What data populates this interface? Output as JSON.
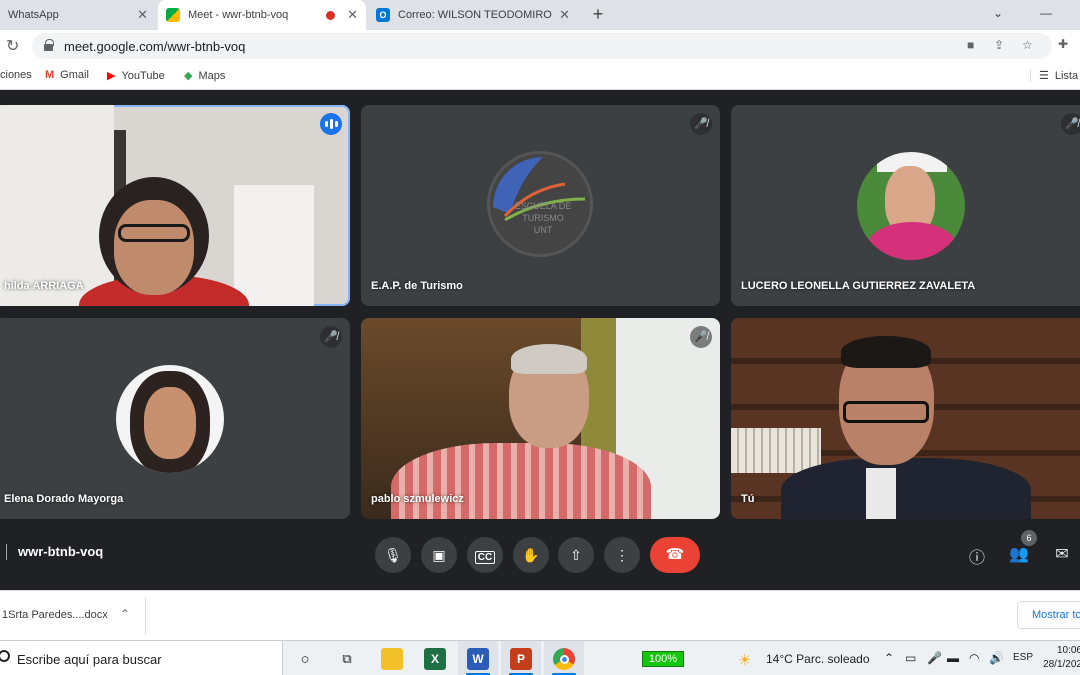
{
  "browser": {
    "tabs": [
      {
        "title": "WhatsApp",
        "active": false
      },
      {
        "title": "Meet - wwr-btnb-voq",
        "active": true
      },
      {
        "title": "Correo: WILSON TEODOMIRO SA",
        "active": false
      }
    ],
    "url": "meet.google.com/wwr-btnb-voq",
    "bookmarks": [
      {
        "label": "ciones",
        "icon": "apps-icon"
      },
      {
        "label": "Gmail",
        "icon": "gmail-icon",
        "color": "#ea4335"
      },
      {
        "label": "YouTube",
        "icon": "youtube-icon",
        "color": "#ff0000"
      },
      {
        "label": "Maps",
        "icon": "maps-icon",
        "color": "#34a853"
      }
    ],
    "reading_list": "Lista"
  },
  "meet": {
    "meeting_code": "wwr-btnb-voq",
    "participant_count": "6",
    "participants": [
      {
        "name": "hilda ARRIAGA",
        "speaking": true,
        "muted": false,
        "video": true
      },
      {
        "name": "E.A.P. de Turismo",
        "speaking": false,
        "muted": true,
        "video": false
      },
      {
        "name": "LUCERO LEONELLA GUTIERREZ ZAVALETA",
        "speaking": false,
        "muted": true,
        "video": false
      },
      {
        "name": "Elena Dorado Mayorga",
        "speaking": false,
        "muted": true,
        "video": false
      },
      {
        "name": "pablo szmulewicz",
        "speaking": false,
        "muted": true,
        "video": true
      },
      {
        "name": "Tú",
        "speaking": false,
        "muted": false,
        "video": true
      }
    ],
    "logo_text": {
      "line1": "ESCUELA DE",
      "line2": "TURISMO",
      "line3": "UNT"
    },
    "controls": [
      "mic-icon",
      "camera-icon",
      "captions-icon",
      "raise-hand-icon",
      "present-icon",
      "more-icon"
    ],
    "colors": {
      "end_call": "#ea4335",
      "speaking_outline": "#8ab4f8",
      "tile_bg": "#3c4043"
    }
  },
  "downloads": {
    "file": "1Srta Paredes....docx",
    "show_all": "Mostrar to"
  },
  "taskbar": {
    "search_placeholder": "Escribe aquí para buscar",
    "battery": "100%",
    "temperature": "14°C",
    "weather": "Parc. soleado",
    "language": "ESP",
    "time": "10:06",
    "date": "28/1/202"
  }
}
